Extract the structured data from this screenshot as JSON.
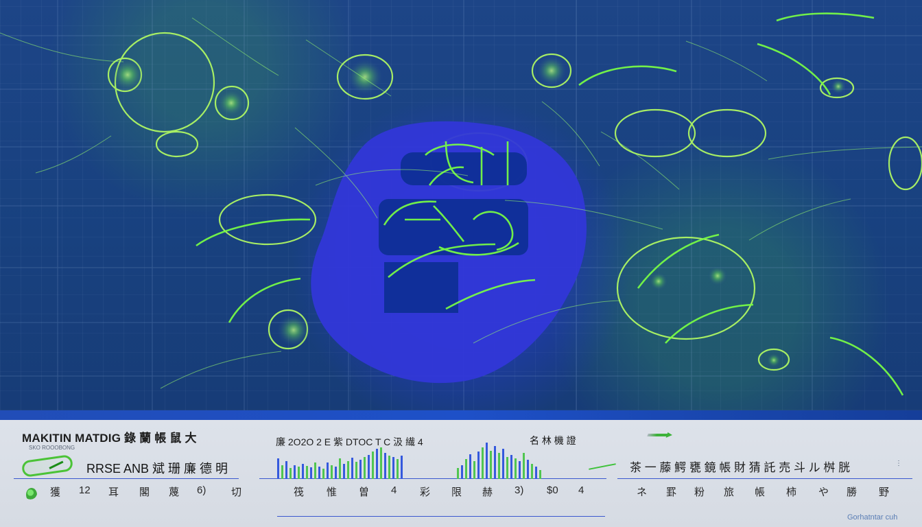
{
  "footer": {
    "title": "MAKITIN MATDIG 錄 蘭 帳 鼠 大",
    "subtext": "SKO ROOOBONG",
    "left_label": "RRSE ANB 斌 珊 廉 德 明",
    "chart_caption": "廉 2O2O 2 E 紫 DTOC T C 汲 繊 4",
    "middle_label": "名 林 機 證",
    "right_label": "茶 一 藤 鰐 甕 鏡 帳 財 猜 託 売 斗 ル 桝 胱",
    "watermark": "Gorhatntar cuh",
    "right_mark": "⋮",
    "axis_labels": [
      "獲",
      "12",
      "耳",
      "閣",
      "蔑",
      "6)",
      "切",
      "筏",
      "惟",
      "曽",
      "4",
      "彩",
      "限",
      "赫",
      "3)",
      "$0",
      "4",
      "ネ",
      "罫",
      "粉",
      "旅",
      "帳",
      "柿",
      "や",
      "勝",
      "野"
    ]
  }
}
